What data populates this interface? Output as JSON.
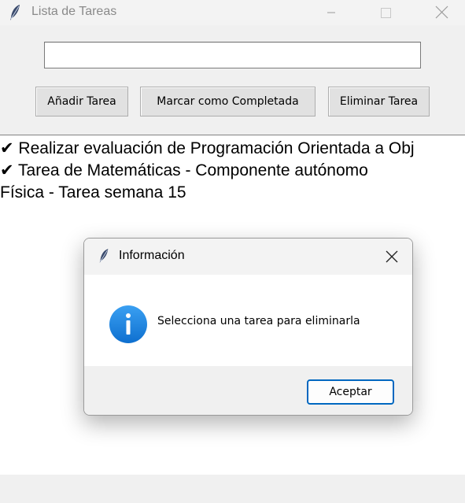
{
  "window": {
    "title": "Lista de Tareas",
    "icon": "feather-icon"
  },
  "entry": {
    "value": ""
  },
  "buttons": {
    "add": "Añadir Tarea",
    "mark": "Marcar como Completada",
    "delete": "Eliminar Tarea"
  },
  "tasks": [
    "✔ Realizar evaluación de Programación Orientada a Obj",
    "✔ Tarea de Matemáticas - Componente autónomo",
    "Física - Tarea semana 15"
  ],
  "dialog": {
    "title": "Información",
    "message": "Selecciona una tarea para eliminarla",
    "ok_label": "Aceptar",
    "icon": "info-icon",
    "colors": {
      "info_blue": "#1a84e0",
      "button_border": "#0067c0"
    }
  }
}
